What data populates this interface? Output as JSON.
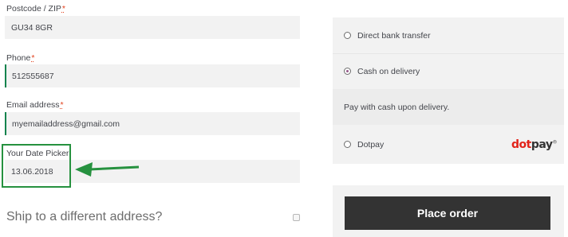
{
  "billing": {
    "postcode": {
      "label": "Postcode / ZIP",
      "required_mark": "*",
      "value": "GU34 8GR"
    },
    "phone": {
      "label": "Phone",
      "required_mark": "*",
      "value": "512555687"
    },
    "email": {
      "label": "Email address",
      "required_mark": "*",
      "value": "myemailaddress@gmail.com"
    },
    "date_picker": {
      "label": "Your Date Picker",
      "value": "13.06.2018"
    }
  },
  "annotation": {
    "highlight_color": "#26913f"
  },
  "shipping": {
    "label": "Ship to a different address?",
    "checked": false
  },
  "payment": {
    "methods": [
      {
        "label": "Direct bank transfer",
        "selected": false
      },
      {
        "label": "Cash on delivery",
        "selected": true,
        "description": "Pay with cash upon delivery."
      },
      {
        "label": "Dotpay",
        "selected": false,
        "logo_text_a": "dot",
        "logo_text_b": "pay",
        "logo_mark": "®"
      }
    ]
  },
  "place_order": {
    "label": "Place order"
  },
  "colors": {
    "accent": "#96588a",
    "valid": "#0f834d",
    "required": "#e2401c",
    "button": "#333333"
  }
}
